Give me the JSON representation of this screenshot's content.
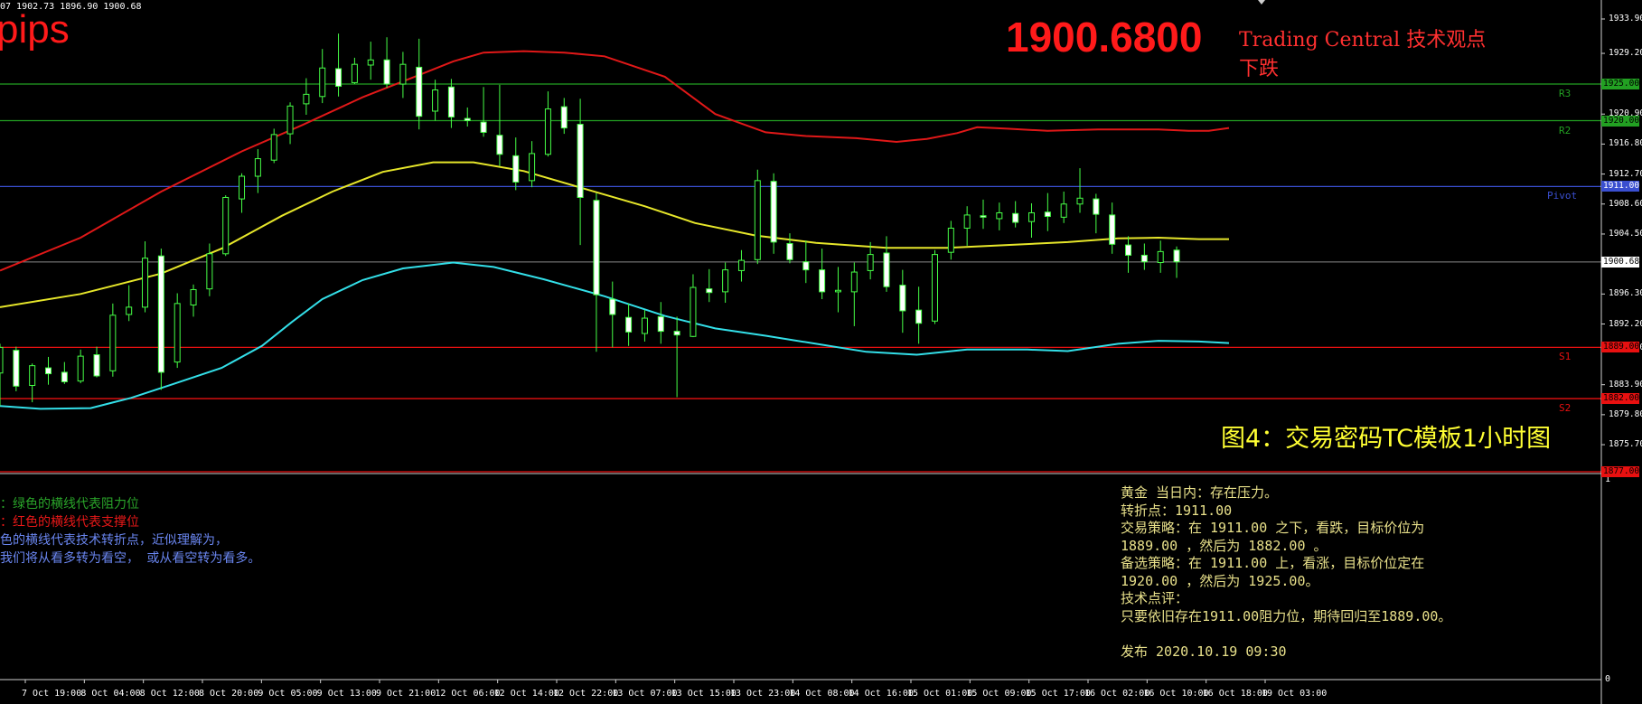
{
  "header": {
    "ohlc_readout": "07 1902.73 1896.90 1900.68",
    "pips_label": "pips",
    "current_price": "1900.6800",
    "tc_title": "Trading Central 技术观点",
    "tc_signal": "下跌",
    "figure_caption": "图4：交易密码TC模板1小时图"
  },
  "legend": {
    "line1": "：绿色的横线代表阻力位",
    "line2": "：红色的横线代表支撑位",
    "line3": "色的横线代表技术转折点，近似理解为，",
    "line4": "我们将从看多转为看空， 或从看空转为看多。"
  },
  "analysis": {
    "l1": "黄金 当日内：存在压力。",
    "l2": "转折点：1911.00",
    "l3": "交易策略：在 1911.00 之下，看跌，目标价位为",
    "l4": "1889.00 ，然后为 1882.00 。",
    "l5": "备选策略：在 1911.00  上，看涨，目标价位定在",
    "l6": "1920.00 ，然后为 1925.00。",
    "l7": "技术点评：",
    "l8": "只要依旧存在1911.00阻力位，期待回归至1889.00。",
    "l9": "",
    "l10": "发布 2020.10.19 09:30"
  },
  "colors": {
    "resistance": "#22a022",
    "support": "#e81010",
    "pivot": "#3a4fd0",
    "ma_upper": "#e01818",
    "ma_mid": "#e6e62a",
    "ma_lower": "#33dfe8",
    "candle": "#46ff46",
    "axis_text": "#ffffff"
  },
  "chart_data": {
    "type": "line",
    "title": "",
    "y_axis_ticks": [
      "1933.90",
      "1929.20",
      "1920.90",
      "1916.80",
      "1912.70",
      "1908.60",
      "1904.50",
      "1896.30",
      "1892.20",
      "1888.90",
      "1883.90",
      "1879.80",
      "1875.70"
    ],
    "ylim": [
      1872.0,
      1936.0
    ],
    "x_axis_ticks": [
      "7 Oct 19:00",
      "8 Oct 04:00",
      "8 Oct 12:00",
      "8 Oct 20:00",
      "9 Oct 05:00",
      "9 Oct 13:00",
      "9 Oct 21:00",
      "12 Oct 06:00",
      "12 Oct 14:00",
      "12 Oct 22:00",
      "13 Oct 07:00",
      "13 Oct 15:00",
      "13 Oct 23:00",
      "14 Oct 08:00",
      "14 Oct 16:00",
      "15 Oct 01:00",
      "15 Oct 09:00",
      "15 Oct 17:00",
      "16 Oct 02:00",
      "16 Oct 10:00",
      "16 Oct 18:00",
      "19 Oct 03:00"
    ],
    "levels": [
      {
        "name": "R3",
        "price": 1925.0,
        "label": "1925.00",
        "kind": "resistance"
      },
      {
        "name": "R2",
        "price": 1920.0,
        "label": "1920.00",
        "kind": "resistance"
      },
      {
        "name": "Pivot",
        "price": 1911.0,
        "label": "1911.00",
        "kind": "pivot"
      },
      {
        "name": "S1",
        "price": 1889.0,
        "label": "1889.00",
        "kind": "support"
      },
      {
        "name": "S2",
        "price": 1882.0,
        "label": "1882.00",
        "kind": "support"
      },
      {
        "name": "",
        "price": 1872.0,
        "label": "1877.00",
        "kind": "support"
      }
    ],
    "current_price_tag": "1900.68",
    "current_price": 1900.68,
    "series": [
      {
        "name": "",
        "color": "#e01818",
        "points": [
          [
            0,
            1899.5
          ],
          [
            40,
            1904.0
          ],
          [
            80,
            1910.3
          ],
          [
            120,
            1915.8
          ],
          [
            150,
            1919.4
          ],
          [
            180,
            1923.2
          ],
          [
            205,
            1925.9
          ],
          [
            225,
            1928.1
          ],
          [
            240,
            1929.3
          ],
          [
            260,
            1929.5
          ],
          [
            280,
            1929.3
          ],
          [
            300,
            1928.8
          ],
          [
            330,
            1926.0
          ],
          [
            355,
            1920.9
          ],
          [
            380,
            1918.4
          ],
          [
            400,
            1917.9
          ],
          [
            425,
            1917.6
          ],
          [
            445,
            1917.1
          ],
          [
            460,
            1917.5
          ],
          [
            475,
            1918.3
          ],
          [
            485,
            1919.1
          ],
          [
            500,
            1918.9
          ],
          [
            520,
            1918.6
          ],
          [
            545,
            1918.8
          ],
          [
            560,
            1918.8
          ],
          [
            575,
            1918.8
          ],
          [
            590,
            1918.6
          ],
          [
            600,
            1918.6
          ],
          [
            610,
            1919.0
          ]
        ]
      },
      {
        "name": "",
        "color": "#e6e62a",
        "points": [
          [
            0,
            1894.5
          ],
          [
            40,
            1896.3
          ],
          [
            80,
            1899.1
          ],
          [
            110,
            1902.5
          ],
          [
            140,
            1907.0
          ],
          [
            165,
            1910.3
          ],
          [
            190,
            1913.0
          ],
          [
            215,
            1914.3
          ],
          [
            235,
            1914.3
          ],
          [
            260,
            1913.1
          ],
          [
            290,
            1910.7
          ],
          [
            320,
            1908.3
          ],
          [
            345,
            1906.0
          ],
          [
            375,
            1904.3
          ],
          [
            405,
            1903.3
          ],
          [
            440,
            1902.6
          ],
          [
            470,
            1902.6
          ],
          [
            500,
            1903.0
          ],
          [
            530,
            1903.4
          ],
          [
            555,
            1903.9
          ],
          [
            575,
            1904.0
          ],
          [
            595,
            1903.8
          ],
          [
            610,
            1903.8
          ]
        ]
      },
      {
        "name": "",
        "color": "#33dfe8",
        "points": [
          [
            0,
            1881.0
          ],
          [
            20,
            1880.6
          ],
          [
            45,
            1880.7
          ],
          [
            65,
            1882.1
          ],
          [
            85,
            1883.9
          ],
          [
            110,
            1886.2
          ],
          [
            130,
            1889.2
          ],
          [
            145,
            1892.5
          ],
          [
            160,
            1895.6
          ],
          [
            180,
            1898.2
          ],
          [
            200,
            1899.8
          ],
          [
            225,
            1900.6
          ],
          [
            245,
            1900.0
          ],
          [
            270,
            1898.3
          ],
          [
            300,
            1896.0
          ],
          [
            330,
            1893.3
          ],
          [
            355,
            1891.6
          ],
          [
            380,
            1890.6
          ],
          [
            405,
            1889.5
          ],
          [
            430,
            1888.4
          ],
          [
            455,
            1888.0
          ],
          [
            480,
            1888.7
          ],
          [
            510,
            1888.7
          ],
          [
            530,
            1888.5
          ],
          [
            555,
            1889.5
          ],
          [
            575,
            1889.9
          ],
          [
            595,
            1889.8
          ],
          [
            610,
            1889.6
          ]
        ]
      }
    ],
    "candles": [
      [
        0,
        1885.5,
        1889.5,
        1881.0,
        1889.0
      ],
      [
        8,
        1888.6,
        1889.1,
        1883.0,
        1883.7
      ],
      [
        16,
        1883.8,
        1886.8,
        1881.5,
        1886.5
      ],
      [
        24,
        1886.2,
        1887.7,
        1883.9,
        1885.4
      ],
      [
        32,
        1885.6,
        1887.0,
        1884.0,
        1884.3
      ],
      [
        40,
        1884.4,
        1888.7,
        1884.1,
        1887.8
      ],
      [
        48,
        1888.0,
        1889.1,
        1884.9,
        1885.1
      ],
      [
        56,
        1885.8,
        1895.0,
        1885.0,
        1893.4
      ],
      [
        64,
        1893.5,
        1897.5,
        1892.6,
        1894.5
      ],
      [
        72,
        1894.5,
        1903.5,
        1893.8,
        1901.2
      ],
      [
        80,
        1901.5,
        1902.5,
        1883.2,
        1885.6
      ],
      [
        88,
        1887.0,
        1896.4,
        1886.2,
        1895.0
      ],
      [
        96,
        1894.8,
        1897.6,
        1893.2,
        1896.9
      ],
      [
        104,
        1897.0,
        1903.2,
        1896.0,
        1901.8
      ],
      [
        112,
        1901.8,
        1909.8,
        1901.5,
        1909.5
      ],
      [
        120,
        1909.3,
        1912.8,
        1907.4,
        1912.4
      ],
      [
        128,
        1912.4,
        1916.1,
        1910.1,
        1914.8
      ],
      [
        136,
        1914.6,
        1918.9,
        1914.2,
        1918.1
      ],
      [
        144,
        1918.2,
        1922.5,
        1916.8,
        1922.0
      ],
      [
        152,
        1922.3,
        1925.8,
        1920.8,
        1923.6
      ],
      [
        160,
        1923.3,
        1929.8,
        1922.4,
        1927.2
      ],
      [
        168,
        1927.1,
        1931.9,
        1923.3,
        1924.7
      ],
      [
        176,
        1925.2,
        1928.6,
        1925.0,
        1927.7
      ],
      [
        184,
        1927.6,
        1930.8,
        1925.6,
        1928.3
      ],
      [
        192,
        1928.3,
        1931.4,
        1924.5,
        1925.0
      ],
      [
        200,
        1925.0,
        1929.4,
        1923.1,
        1927.7
      ],
      [
        208,
        1927.3,
        1931.2,
        1918.8,
        1920.6
      ],
      [
        216,
        1921.3,
        1925.6,
        1920.0,
        1924.2
      ],
      [
        224,
        1924.6,
        1925.7,
        1919.0,
        1920.5
      ],
      [
        232,
        1920.3,
        1921.8,
        1919.2,
        1920.0
      ],
      [
        240,
        1919.8,
        1924.6,
        1917.8,
        1918.4
      ],
      [
        248,
        1918.0,
        1924.9,
        1913.8,
        1915.4
      ],
      [
        256,
        1915.2,
        1917.7,
        1910.5,
        1911.6
      ],
      [
        264,
        1911.8,
        1917.2,
        1910.9,
        1915.5
      ],
      [
        272,
        1915.4,
        1924.0,
        1915.1,
        1921.6
      ],
      [
        280,
        1921.9,
        1923.1,
        1918.2,
        1919.0
      ],
      [
        288,
        1919.5,
        1923.0,
        1903.0,
        1909.5
      ],
      [
        296,
        1909.1,
        1910.1,
        1888.4,
        1896.2
      ],
      [
        304,
        1895.6,
        1898.0,
        1889.0,
        1893.5
      ],
      [
        312,
        1893.1,
        1895.0,
        1889.2,
        1891.1
      ],
      [
        320,
        1890.9,
        1894.1,
        1889.8,
        1893.0
      ],
      [
        328,
        1893.2,
        1895.2,
        1889.5,
        1891.2
      ],
      [
        336,
        1891.2,
        1893.2,
        1882.2,
        1890.7
      ],
      [
        344,
        1890.5,
        1899.0,
        1890.4,
        1897.2
      ],
      [
        352,
        1897.0,
        1899.7,
        1895.2,
        1896.5
      ],
      [
        360,
        1896.6,
        1900.6,
        1895.1,
        1899.6
      ],
      [
        368,
        1899.5,
        1902.3,
        1898.0,
        1900.9
      ],
      [
        376,
        1901.0,
        1913.3,
        1900.4,
        1911.8
      ],
      [
        384,
        1911.7,
        1912.8,
        1901.8,
        1903.4
      ],
      [
        392,
        1903.2,
        1904.6,
        1900.5,
        1901.0
      ],
      [
        400,
        1900.7,
        1903.6,
        1897.8,
        1899.6
      ],
      [
        408,
        1899.6,
        1902.5,
        1895.6,
        1896.6
      ],
      [
        416,
        1896.6,
        1900.0,
        1893.8,
        1896.8
      ],
      [
        424,
        1896.6,
        1900.6,
        1891.9,
        1899.3
      ],
      [
        432,
        1899.5,
        1903.4,
        1898.3,
        1901.7
      ],
      [
        440,
        1901.9,
        1904.2,
        1896.6,
        1897.3
      ],
      [
        448,
        1897.5,
        1899.6,
        1891.0,
        1894.0
      ],
      [
        456,
        1894.1,
        1897.3,
        1889.5,
        1892.3
      ],
      [
        464,
        1892.6,
        1902.3,
        1892.2,
        1901.7
      ],
      [
        472,
        1902.0,
        1906.3,
        1901.0,
        1905.3
      ],
      [
        480,
        1905.3,
        1908.3,
        1902.9,
        1907.1
      ],
      [
        488,
        1907.0,
        1909.2,
        1905.2,
        1906.8
      ],
      [
        496,
        1906.6,
        1908.8,
        1905.0,
        1907.4
      ],
      [
        504,
        1907.3,
        1909.0,
        1905.4,
        1906.1
      ],
      [
        512,
        1906.2,
        1908.7,
        1904.0,
        1907.4
      ],
      [
        520,
        1907.5,
        1910.1,
        1904.9,
        1906.9
      ],
      [
        528,
        1906.8,
        1910.3,
        1906.0,
        1908.6
      ],
      [
        536,
        1908.6,
        1913.5,
        1907.4,
        1909.4
      ],
      [
        544,
        1909.3,
        1910.0,
        1904.6,
        1907.2
      ],
      [
        552,
        1907.1,
        1908.8,
        1901.8,
        1903.1
      ],
      [
        560,
        1903.0,
        1904.2,
        1899.2,
        1901.6
      ],
      [
        568,
        1901.6,
        1903.2,
        1899.6,
        1900.7
      ],
      [
        576,
        1900.6,
        1903.6,
        1899.2,
        1902.1
      ],
      [
        584,
        1902.3,
        1902.8,
        1898.5,
        1900.7
      ]
    ]
  }
}
